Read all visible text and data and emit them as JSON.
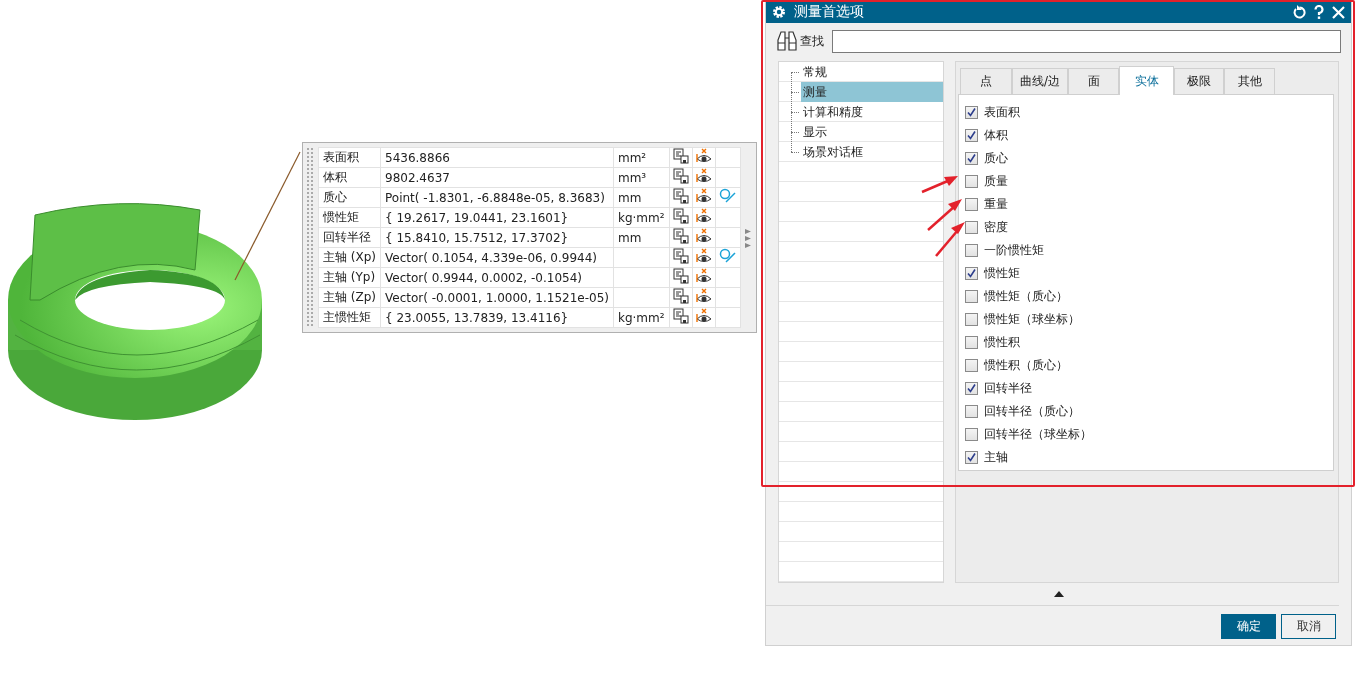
{
  "results": {
    "rows": [
      {
        "label": "表面积",
        "value": "5436.8866",
        "unit": "mm²",
        "locate": false
      },
      {
        "label": "体积",
        "value": "9802.4637",
        "unit": "mm³",
        "locate": false
      },
      {
        "label": "质心",
        "value": "Point( -1.8301, -6.8848e-05, 8.3683)",
        "unit": "mm",
        "locate": true
      },
      {
        "label": "惯性矩",
        "value": "{ 19.2617, 19.0441, 23.1601}",
        "unit": "kg·mm²",
        "locate": false
      },
      {
        "label": "回转半径",
        "value": "{ 15.8410, 15.7512, 17.3702}",
        "unit": "mm",
        "locate": false
      },
      {
        "label": "主轴 (Xp)",
        "value": "Vector( 0.1054, 4.339e-06, 0.9944)",
        "locate": true
      },
      {
        "label": "主轴 (Yp)",
        "value": "Vector( 0.9944, 0.0002, -0.1054)",
        "locate": false
      },
      {
        "label": "主轴 (Zp)",
        "value": "Vector( -0.0001, 1.0000, 1.1521e-05)",
        "locate": false
      },
      {
        "label": "主惯性矩",
        "value": "{ 23.0055, 13.7839, 13.4116}",
        "unit": "kg·mm²",
        "locate": false
      }
    ]
  },
  "dialog": {
    "title": "测量首选项",
    "search": {
      "label": "查找"
    },
    "tree": [
      {
        "label": "常规",
        "selected": false
      },
      {
        "label": "测量",
        "selected": true
      },
      {
        "label": "计算和精度",
        "selected": false
      },
      {
        "label": "显示",
        "selected": false
      },
      {
        "label": "场景对话框",
        "selected": false
      }
    ],
    "tabs": [
      {
        "label": "点",
        "selected": false
      },
      {
        "label": "曲线/边",
        "selected": false
      },
      {
        "label": "面",
        "selected": false
      },
      {
        "label": "实体",
        "selected": true
      },
      {
        "label": "极限",
        "selected": false
      },
      {
        "label": "其他",
        "selected": false
      }
    ],
    "options": [
      {
        "label": "表面积",
        "checked": true
      },
      {
        "label": "体积",
        "checked": true
      },
      {
        "label": "质心",
        "checked": true
      },
      {
        "label": "质量",
        "checked": false
      },
      {
        "label": "重量",
        "checked": false
      },
      {
        "label": "密度",
        "checked": false
      },
      {
        "label": "一阶惯性矩",
        "checked": false
      },
      {
        "label": "惯性矩",
        "checked": true
      },
      {
        "label": "惯性矩（质心）",
        "checked": false
      },
      {
        "label": "惯性矩（球坐标）",
        "checked": false
      },
      {
        "label": "惯性积",
        "checked": false
      },
      {
        "label": "惯性积（质心）",
        "checked": false
      },
      {
        "label": "回转半径",
        "checked": true
      },
      {
        "label": "回转半径（质心）",
        "checked": false
      },
      {
        "label": "回转半径（球坐标）",
        "checked": false
      },
      {
        "label": "主轴",
        "checked": true
      }
    ],
    "buttons": [
      {
        "label": "确定",
        "kind": "primary"
      },
      {
        "label": "取消",
        "kind": "secondary"
      }
    ]
  }
}
